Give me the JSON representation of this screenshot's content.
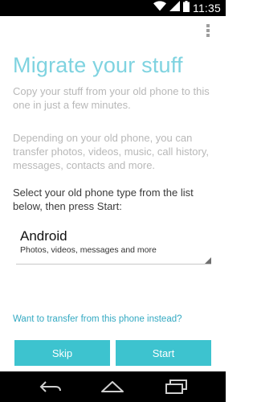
{
  "status_bar": {
    "time": "11:35",
    "icons": [
      "wifi-icon",
      "signal-icon",
      "battery-icon"
    ]
  },
  "title": "Migrate your stuff",
  "intro": "Copy your stuff from your old phone to this one in just a few minutes.",
  "details": "Depending on your old phone, you can transfer photos, videos, music, call history, messages, contacts and more.",
  "instruction": "Select your old phone type from the list below, then press Start:",
  "phone_type": {
    "selected": "Android",
    "description": "Photos, videos, messages and more"
  },
  "transfer_link": "Want to transfer from this phone instead?",
  "buttons": {
    "skip": "Skip",
    "start": "Start"
  },
  "nav_icons": [
    "back-icon",
    "home-icon",
    "recent-apps-icon"
  ],
  "colors": {
    "accent": "#3dc3cf",
    "title": "#7fd3e0",
    "link": "#33a9c2"
  }
}
